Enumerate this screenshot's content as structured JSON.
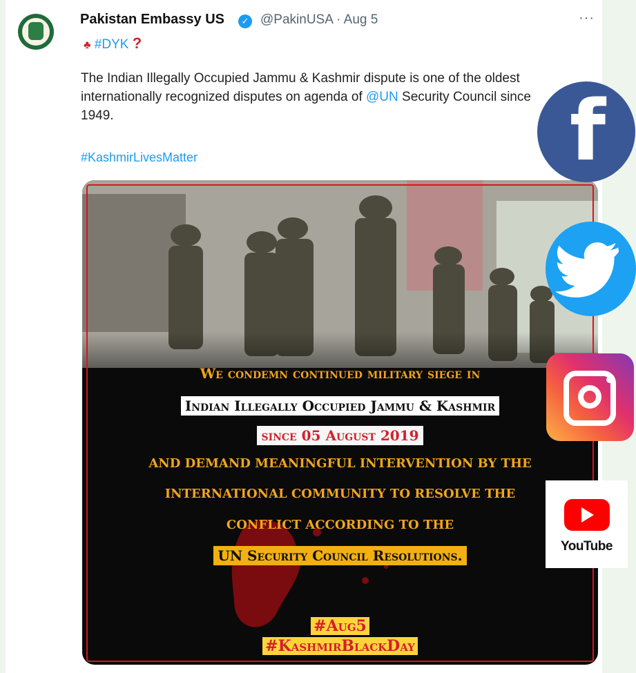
{
  "tweet": {
    "name": "Pakistan Embassy US",
    "handle_date": "@PakinUSA · Aug 5",
    "more": "···",
    "dyk": "#DYK",
    "text_part1": "The Indian Illegally Occupied Jammu & Kashmir dispute is one of the oldest internationally recognized disputes on agenda of ",
    "mention": "@UN",
    "text_part2": " Security Council since 1949.",
    "hashtag": "#KashmirLivesMatter"
  },
  "poster": {
    "line1": "We condemn continued military siege in",
    "line2": "Indian Illegally Occupied Jammu & Kashmir",
    "line3": "since 05 August 2019",
    "line4": "and demand meaningful intervention by the",
    "line5": "international community to resolve the",
    "line6": "conflict according to the",
    "line7": "UN Security Council Resolutions.",
    "tag1": "#Aug5",
    "tag2": "#KashmirBlackDay"
  },
  "social": {
    "youtube_label": "YouTube"
  },
  "colors": {
    "link": "#1d9bf0",
    "facebook": "#3b5896",
    "twitter": "#1da1f2",
    "poster_red": "#d3202a",
    "poster_gold": "#f2a51c"
  }
}
